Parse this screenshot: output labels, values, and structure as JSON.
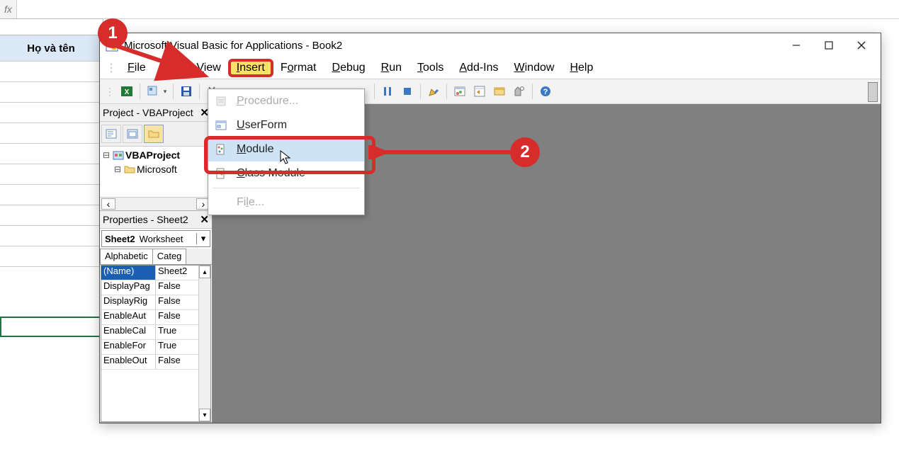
{
  "excel": {
    "fx_label": "fx",
    "header": "Họ và tên"
  },
  "window_title": "Microsoft Visual Basic for Applications - Book2",
  "menubar": {
    "file": "File",
    "edit": "Edit",
    "view": "View",
    "insert": "Insert",
    "format": "Format",
    "debug": "Debug",
    "run": "Run",
    "tools": "Tools",
    "addins": "Add-Ins",
    "window": "Window",
    "help": "Help"
  },
  "insert_menu": {
    "procedure": "Procedure...",
    "userform": "UserForm",
    "module": "Module",
    "class_module": "Class Module",
    "file": "File..."
  },
  "project": {
    "pane_title": "Project - VBAProject",
    "root": "VBAProject",
    "child1": "Microsoft"
  },
  "properties": {
    "pane_title": "Properties - Sheet2",
    "obj_name": "Sheet2",
    "obj_type": "Worksheet",
    "tab1": "Alphabetic",
    "tab2": "Categ",
    "rows": [
      {
        "k": "(Name)",
        "v": "Sheet2"
      },
      {
        "k": "DisplayPag",
        "v": "False"
      },
      {
        "k": "DisplayRig",
        "v": "False"
      },
      {
        "k": "EnableAut",
        "v": "False"
      },
      {
        "k": "EnableCal",
        "v": "True"
      },
      {
        "k": "EnableFor",
        "v": "True"
      },
      {
        "k": "EnableOut",
        "v": "False"
      }
    ]
  },
  "callouts": {
    "one": "1",
    "two": "2"
  }
}
